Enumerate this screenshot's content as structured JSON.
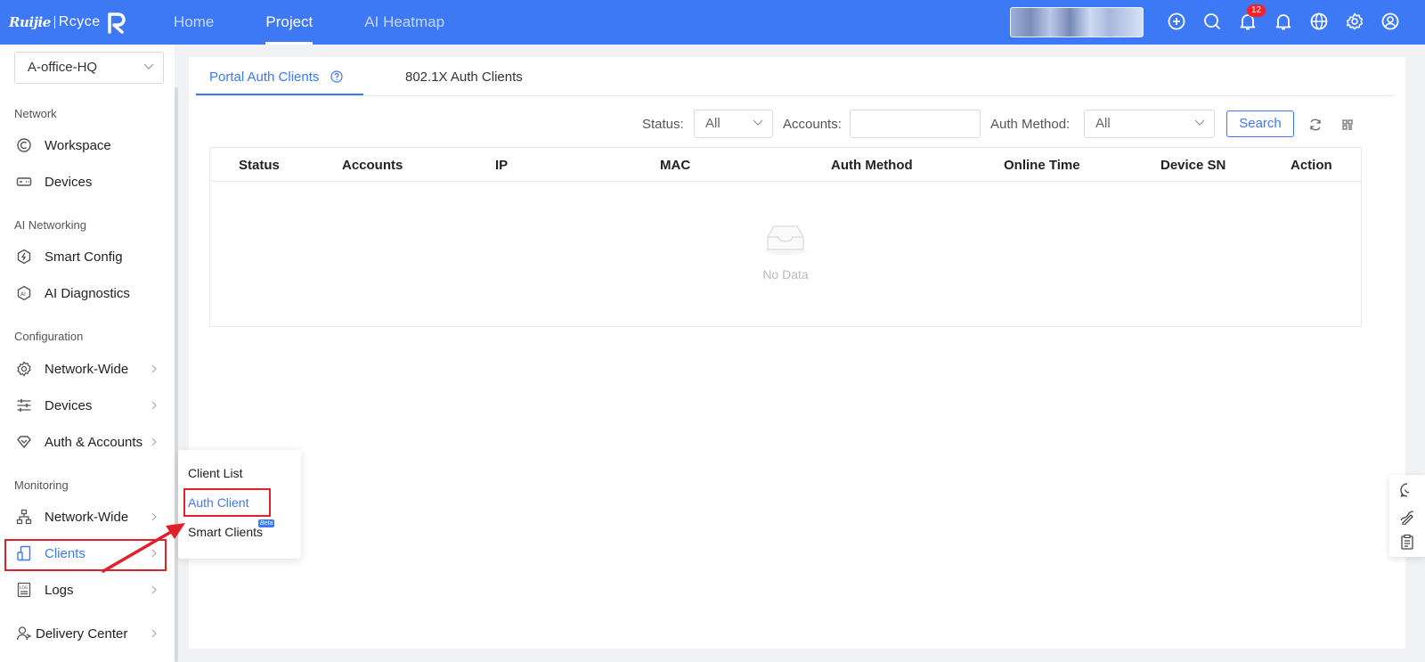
{
  "topbar": {
    "logo_text_1": "Ruijie",
    "logo_text_2": "Rcyce",
    "nav": [
      "Home",
      "Project",
      "AI Heatmap"
    ],
    "notification_count": "12"
  },
  "sidebar": {
    "site_selector": "A-office-HQ",
    "sections": {
      "network": "Network",
      "ai_networking": "AI Networking",
      "configuration": "Configuration",
      "monitoring": "Monitoring"
    },
    "items": {
      "workspace": "Workspace",
      "devices": "Devices",
      "smart_config": "Smart Config",
      "ai_diagnostics": "AI Diagnostics",
      "network_wide_cfg": "Network-Wide",
      "devices_cfg": "Devices",
      "auth_accounts": "Auth & Accounts",
      "network_wide_mon": "Network-Wide",
      "clients": "Clients",
      "logs": "Logs",
      "delivery_center": "Delivery Center"
    }
  },
  "tabs": {
    "portal": "Portal Auth Clients",
    "dot1x": "802.1X Auth Clients"
  },
  "filters": {
    "status_label": "Status:",
    "status_value": "All",
    "accounts_label": "Accounts:",
    "accounts_value": "",
    "auth_method_label": "Auth Method:",
    "auth_method_value": "All",
    "search_button": "Search"
  },
  "table": {
    "columns": [
      "Status",
      "Accounts",
      "IP",
      "MAC",
      "Auth Method",
      "Online Time",
      "Device SN",
      "Action"
    ],
    "rows": [],
    "empty_text": "No Data"
  },
  "flyout": {
    "items": [
      "Client List",
      "Auth Client",
      "Smart Clients"
    ],
    "beta_tag": "Beta"
  },
  "colors": {
    "primary": "#3d78f5",
    "highlight_red": "#e0212b"
  }
}
